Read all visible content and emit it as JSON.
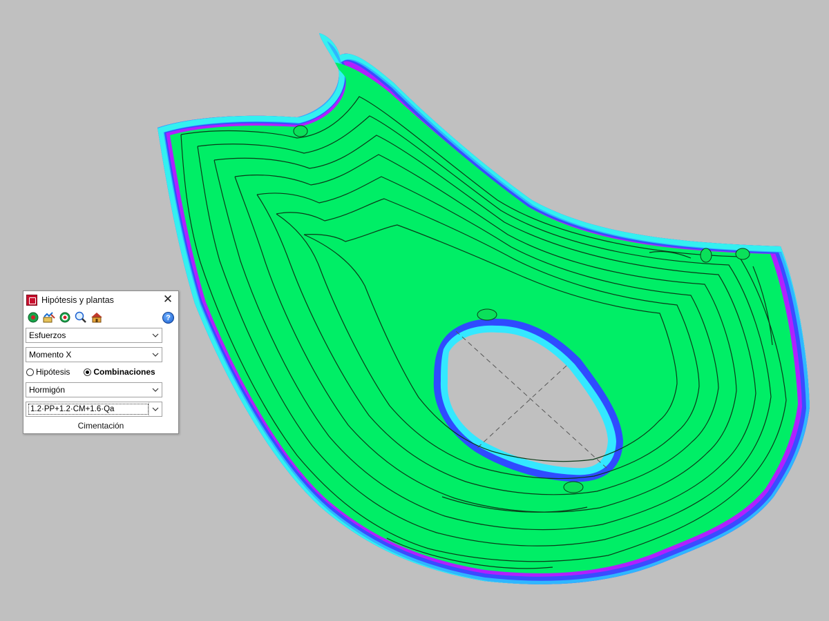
{
  "dialog": {
    "title": "Hipótesis y plantas",
    "close_glyph": "✕",
    "help_glyph": "?",
    "toolbar_icons": [
      "donut-view-icon",
      "edit-chart-icon",
      "contour-rings-icon",
      "zoom-search-icon",
      "building-icon"
    ],
    "result_type": "Esfuerzos",
    "magnitude": "Momento X",
    "radio_hypothesis_label": "Hipótesis",
    "radio_combinations_label": "Combinaciones",
    "selected_radio": "Combinaciones",
    "material": "Hormigón",
    "combination": "1.2·PP+1.2·CM+1.6·Qa",
    "floor_label": "Cimentación",
    "dropdown_arrow_glyph": "﹀"
  },
  "canvas": {
    "background_color": "#c0c0c0",
    "plate_fill_color": "#00ee66",
    "edge_colors": [
      "#33e0ff",
      "#3355ff",
      "#b020ff"
    ]
  }
}
